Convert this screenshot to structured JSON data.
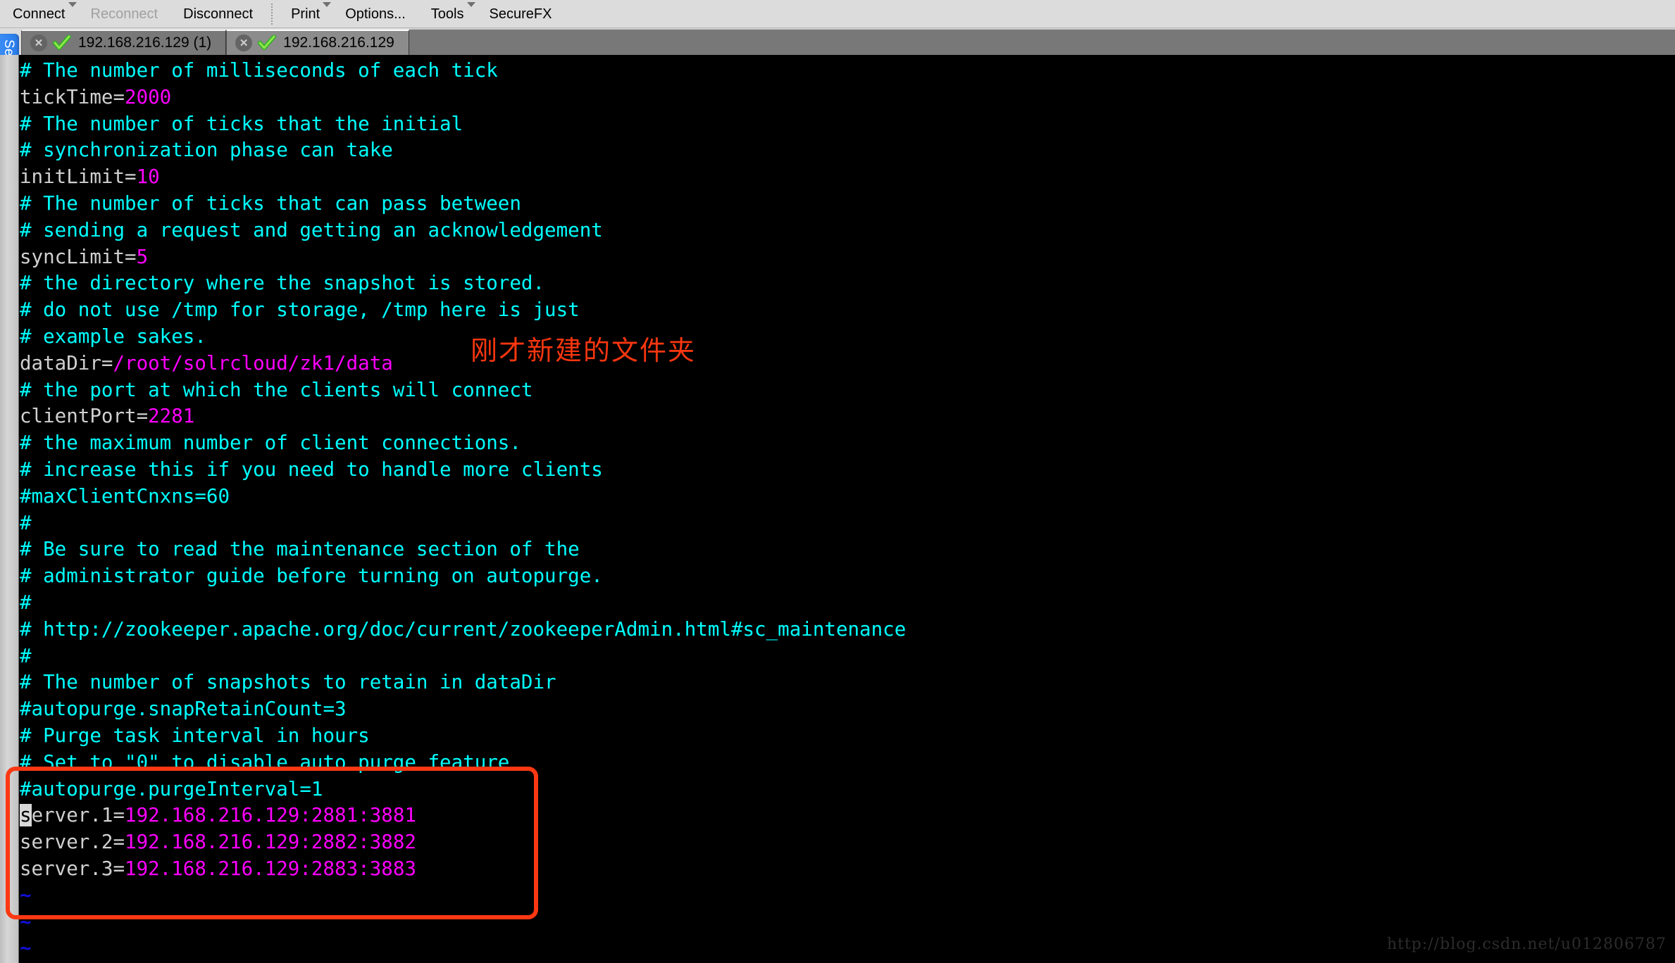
{
  "toolbar": {
    "items": [
      {
        "label": "Connect",
        "icon": "connect-icon",
        "has_caret": true,
        "disabled": false
      },
      {
        "label": "Reconnect",
        "icon": "reconnect-icon",
        "has_caret": false,
        "disabled": true
      },
      {
        "label": "Disconnect",
        "icon": "disconnect-icon",
        "has_caret": false,
        "disabled": false
      },
      {
        "label": "Print",
        "icon": "print-icon",
        "has_caret": true,
        "disabled": false
      },
      {
        "label": "Options...",
        "icon": "options-icon",
        "has_caret": false,
        "disabled": false
      },
      {
        "label": "Tools",
        "icon": "tools-icon",
        "has_caret": true,
        "disabled": false
      },
      {
        "label": "SecureFX",
        "icon": "securefx-icon",
        "has_caret": false,
        "disabled": false
      }
    ]
  },
  "tabs": [
    {
      "label": "192.168.216.129 (1)",
      "active": false,
      "close_icon": "close-icon",
      "status_icon": "green-check-icon"
    },
    {
      "label": "192.168.216.129",
      "active": true,
      "close_icon": "close-icon",
      "status_icon": "green-check-icon"
    }
  ],
  "session_manager": {
    "label": "Session Manager"
  },
  "annotations": {
    "chinese_note": "刚才新建的文件夹",
    "note_color": "#f8360f",
    "highlight_box_color": "#fc3813"
  },
  "watermark": {
    "text": "http://blog.csdn.net/u012806787"
  },
  "terminal": {
    "colors": {
      "background": "#000000",
      "comment": "#00ffff",
      "key": "#d0d0d0",
      "value": "#ff00ff",
      "tilde": "#1010d8",
      "cursor_bg": "#d8d8d8"
    },
    "cursor": {
      "line": 31,
      "column": 0,
      "char": "s"
    },
    "lines": [
      {
        "type": "comment",
        "text": "# The number of milliseconds of each tick"
      },
      {
        "type": "kv",
        "key": "tickTime=",
        "value": "2000"
      },
      {
        "type": "comment",
        "text": "# The number of ticks that the initial"
      },
      {
        "type": "comment",
        "text": "# synchronization phase can take"
      },
      {
        "type": "kv",
        "key": "initLimit=",
        "value": "10"
      },
      {
        "type": "comment",
        "text": "# The number of ticks that can pass between"
      },
      {
        "type": "comment",
        "text": "# sending a request and getting an acknowledgement"
      },
      {
        "type": "kv",
        "key": "syncLimit=",
        "value": "5"
      },
      {
        "type": "comment",
        "text": "# the directory where the snapshot is stored."
      },
      {
        "type": "comment",
        "text": "# do not use /tmp for storage, /tmp here is just"
      },
      {
        "type": "comment",
        "text": "# example sakes."
      },
      {
        "type": "kv",
        "key": "dataDir=",
        "value": "/root/solrcloud/zk1/data"
      },
      {
        "type": "comment",
        "text": "# the port at which the clients will connect"
      },
      {
        "type": "kv",
        "key": "clientPort=",
        "value": "2281"
      },
      {
        "type": "comment",
        "text": "# the maximum number of client connections."
      },
      {
        "type": "comment",
        "text": "# increase this if you need to handle more clients"
      },
      {
        "type": "comment",
        "text": "#maxClientCnxns=60"
      },
      {
        "type": "comment",
        "text": "#"
      },
      {
        "type": "comment",
        "text": "# Be sure to read the maintenance section of the"
      },
      {
        "type": "comment",
        "text": "# administrator guide before turning on autopurge."
      },
      {
        "type": "comment",
        "text": "#"
      },
      {
        "type": "comment",
        "text": "# http://zookeeper.apache.org/doc/current/zookeeperAdmin.html#sc_maintenance"
      },
      {
        "type": "comment",
        "text": "#"
      },
      {
        "type": "comment",
        "text": "# The number of snapshots to retain in dataDir"
      },
      {
        "type": "comment",
        "text": "#autopurge.snapRetainCount=3"
      },
      {
        "type": "comment",
        "text": "# Purge task interval in hours"
      },
      {
        "type": "comment",
        "text": "# Set to \"0\" to disable auto purge feature"
      },
      {
        "type": "comment",
        "text": "#autopurge.purgeInterval=1"
      },
      {
        "type": "kv-cursor",
        "key": "server.1=",
        "value": "192.168.216.129:2881:3881"
      },
      {
        "type": "kv",
        "key": "server.2=",
        "value": "192.168.216.129:2882:3882"
      },
      {
        "type": "kv",
        "key": "server.3=",
        "value": "192.168.216.129:2883:3883"
      },
      {
        "type": "tilde",
        "text": "~"
      },
      {
        "type": "tilde",
        "text": "~"
      },
      {
        "type": "tilde",
        "text": "~"
      }
    ]
  }
}
